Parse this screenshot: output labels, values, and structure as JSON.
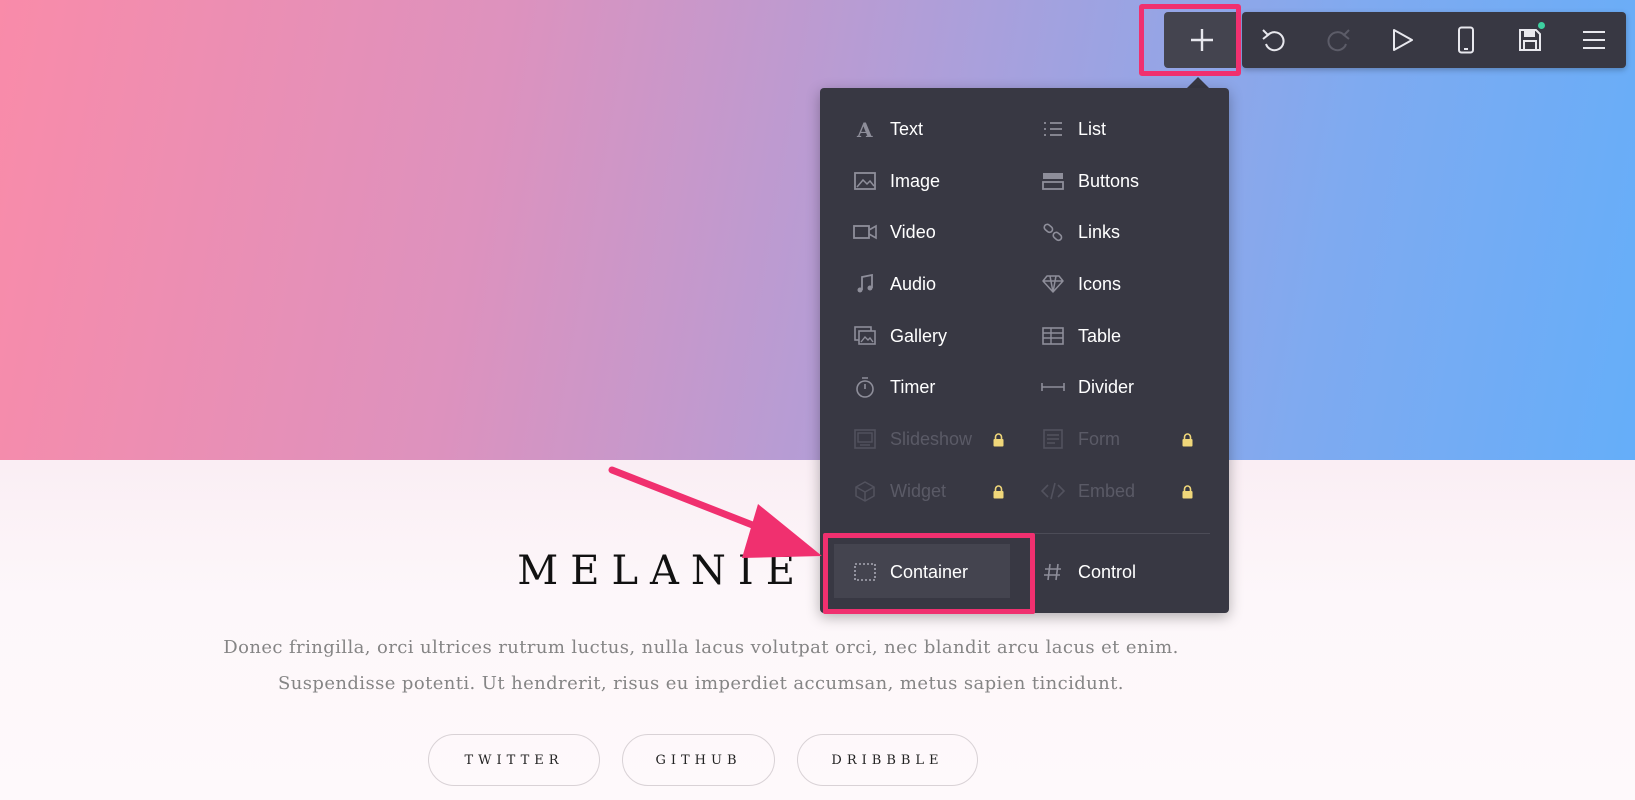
{
  "hero": {
    "colors": {
      "start": "#f98ba9",
      "end": "#65aef9"
    }
  },
  "profile": {
    "name": "MELANIE W",
    "bio_line1": "Donec fringilla, orci ultrices rutrum luctus, nulla lacus volutpat orci, nec blandit arcu lacus et enim.",
    "bio_line2": "Suspendisse potenti. Ut hendrerit, risus eu imperdiet accumsan, metus sapien tincidunt."
  },
  "socials": [
    {
      "label": "TWITTER"
    },
    {
      "label": "GITHUB"
    },
    {
      "label": "DRIBBBLE"
    }
  ],
  "toolbar": {
    "items": [
      {
        "icon": "plus-icon"
      },
      {
        "icon": "undo-icon"
      },
      {
        "icon": "redo-icon"
      },
      {
        "icon": "play-icon"
      },
      {
        "icon": "mobile-icon"
      },
      {
        "icon": "save-icon"
      },
      {
        "icon": "menu-icon"
      }
    ]
  },
  "add_menu": {
    "items": [
      {
        "label": "Text",
        "icon": "text-icon",
        "locked": false
      },
      {
        "label": "List",
        "icon": "list-icon",
        "locked": false
      },
      {
        "label": "Image",
        "icon": "image-icon",
        "locked": false
      },
      {
        "label": "Buttons",
        "icon": "buttons-icon",
        "locked": false
      },
      {
        "label": "Video",
        "icon": "video-icon",
        "locked": false
      },
      {
        "label": "Links",
        "icon": "links-icon",
        "locked": false
      },
      {
        "label": "Audio",
        "icon": "audio-icon",
        "locked": false
      },
      {
        "label": "Icons",
        "icon": "diamond-icon",
        "locked": false
      },
      {
        "label": "Gallery",
        "icon": "gallery-icon",
        "locked": false
      },
      {
        "label": "Table",
        "icon": "table-icon",
        "locked": false
      },
      {
        "label": "Timer",
        "icon": "timer-icon",
        "locked": false
      },
      {
        "label": "Divider",
        "icon": "divider-icon",
        "locked": false
      },
      {
        "label": "Slideshow",
        "icon": "slideshow-icon",
        "locked": true
      },
      {
        "label": "Form",
        "icon": "form-icon",
        "locked": true
      },
      {
        "label": "Widget",
        "icon": "widget-icon",
        "locked": true
      },
      {
        "label": "Embed",
        "icon": "embed-icon",
        "locked": true
      }
    ],
    "bottom": [
      {
        "label": "Container",
        "icon": "container-icon"
      },
      {
        "label": "Control",
        "icon": "hash-icon"
      }
    ]
  },
  "highlight_color": "#f0306f"
}
